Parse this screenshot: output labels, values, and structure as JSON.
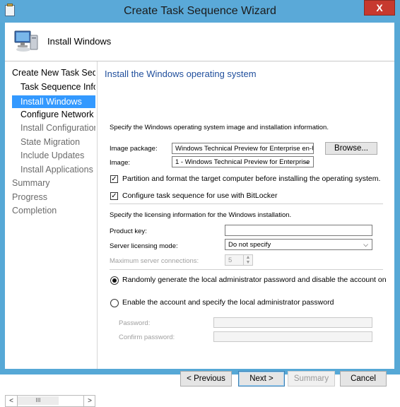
{
  "window": {
    "title": "Create Task Sequence Wizard",
    "close_glyph": "X"
  },
  "header": {
    "title": "Install Windows"
  },
  "nav": {
    "items": [
      {
        "label": "Create New Task Sequ",
        "indent": 0,
        "state": "normal"
      },
      {
        "label": "Task Sequence Infor",
        "indent": 1,
        "state": "normal"
      },
      {
        "label": "Install Windows",
        "indent": 1,
        "state": "selected"
      },
      {
        "label": "Configure Network",
        "indent": 1,
        "state": "normal"
      },
      {
        "label": "Install Configuration",
        "indent": 1,
        "state": "dim"
      },
      {
        "label": "State Migration",
        "indent": 1,
        "state": "dim"
      },
      {
        "label": "Include Updates",
        "indent": 1,
        "state": "dim"
      },
      {
        "label": "Install Applications",
        "indent": 1,
        "state": "dim"
      },
      {
        "label": "Summary",
        "indent": 0,
        "state": "dim"
      },
      {
        "label": "Progress",
        "indent": 0,
        "state": "dim"
      },
      {
        "label": "Completion",
        "indent": 0,
        "state": "dim"
      }
    ],
    "scroll_left": "<",
    "scroll_thumb": "III",
    "scroll_right": ">"
  },
  "content": {
    "title": "Install the Windows operating system",
    "intro": "Specify the Windows operating system image and installation information.",
    "image_package_label": "Image package:",
    "image_package_value": "Windows Technical Preview for Enterprise  en-US",
    "browse_label": "Browse...",
    "image_label": "Image:",
    "image_value": "1 - Windows Technical Preview for Enterprise",
    "partition_label": "Partition and format the target computer before installing the operating system.",
    "bitlocker_label": "Configure task sequence for use with BitLocker",
    "licensing_intro": "Specify the licensing information for the Windows installation.",
    "product_key_label": "Product key:",
    "product_key_value": "",
    "server_mode_label": "Server licensing mode:",
    "server_mode_value": "Do not specify",
    "max_conn_label": "Maximum server connections:",
    "max_conn_value": "5",
    "radio_random_label": "Randomly generate the local administrator password and disable the account on",
    "radio_enable_label": "Enable the account and specify the local administrator password",
    "password_label": "Password:",
    "confirm_label": "Confirm password:"
  },
  "footer": {
    "previous": "< Previous",
    "next": "Next >",
    "summary": "Summary",
    "cancel": "Cancel"
  },
  "colors": {
    "title_bar": "#5aa9d8",
    "selection": "#3399ff",
    "content_title": "#1f4e9c",
    "close": "#c7392f"
  }
}
